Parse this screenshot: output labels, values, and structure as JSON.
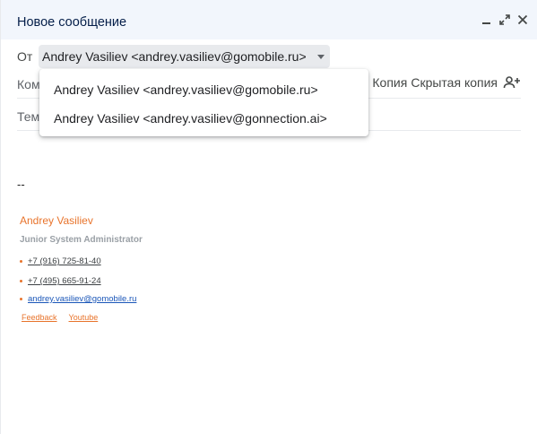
{
  "window": {
    "title": "Новое сообщение"
  },
  "from": {
    "label": "От",
    "selected": "Andrey Vasiliev <andrey.vasiliev@gomobile.ru>",
    "options": [
      "Andrey Vasiliev <andrey.vasiliev@gomobile.ru>",
      "Andrey Vasiliev <andrey.vasiliev@gonnection.ai>"
    ]
  },
  "to": {
    "label": "Кому",
    "cc_label": "Копия",
    "bcc_label": "Скрытая копия"
  },
  "subject": {
    "label": "Тема"
  },
  "signature": {
    "separator": "--",
    "name": "Andrey Vasiliev",
    "role": "Junior System Administrator",
    "phone1": "+7 (916) 725-81-40",
    "phone2": "+7 (495) 665-91-24",
    "email": "andrey.vasiliev@gomobile.ru",
    "link1": "Feedback",
    "link2": "Youtube"
  },
  "icons": {
    "minimize": "minimize-icon",
    "expand": "expand-icon",
    "close": "close-icon",
    "add_recipient": "person-add-icon",
    "dropdown": "caret-down-icon"
  },
  "colors": {
    "titlebar_bg": "#f2f6fc",
    "title_text": "#041e49",
    "signature_accent": "#e8742c",
    "email_link": "#1a56b8"
  }
}
